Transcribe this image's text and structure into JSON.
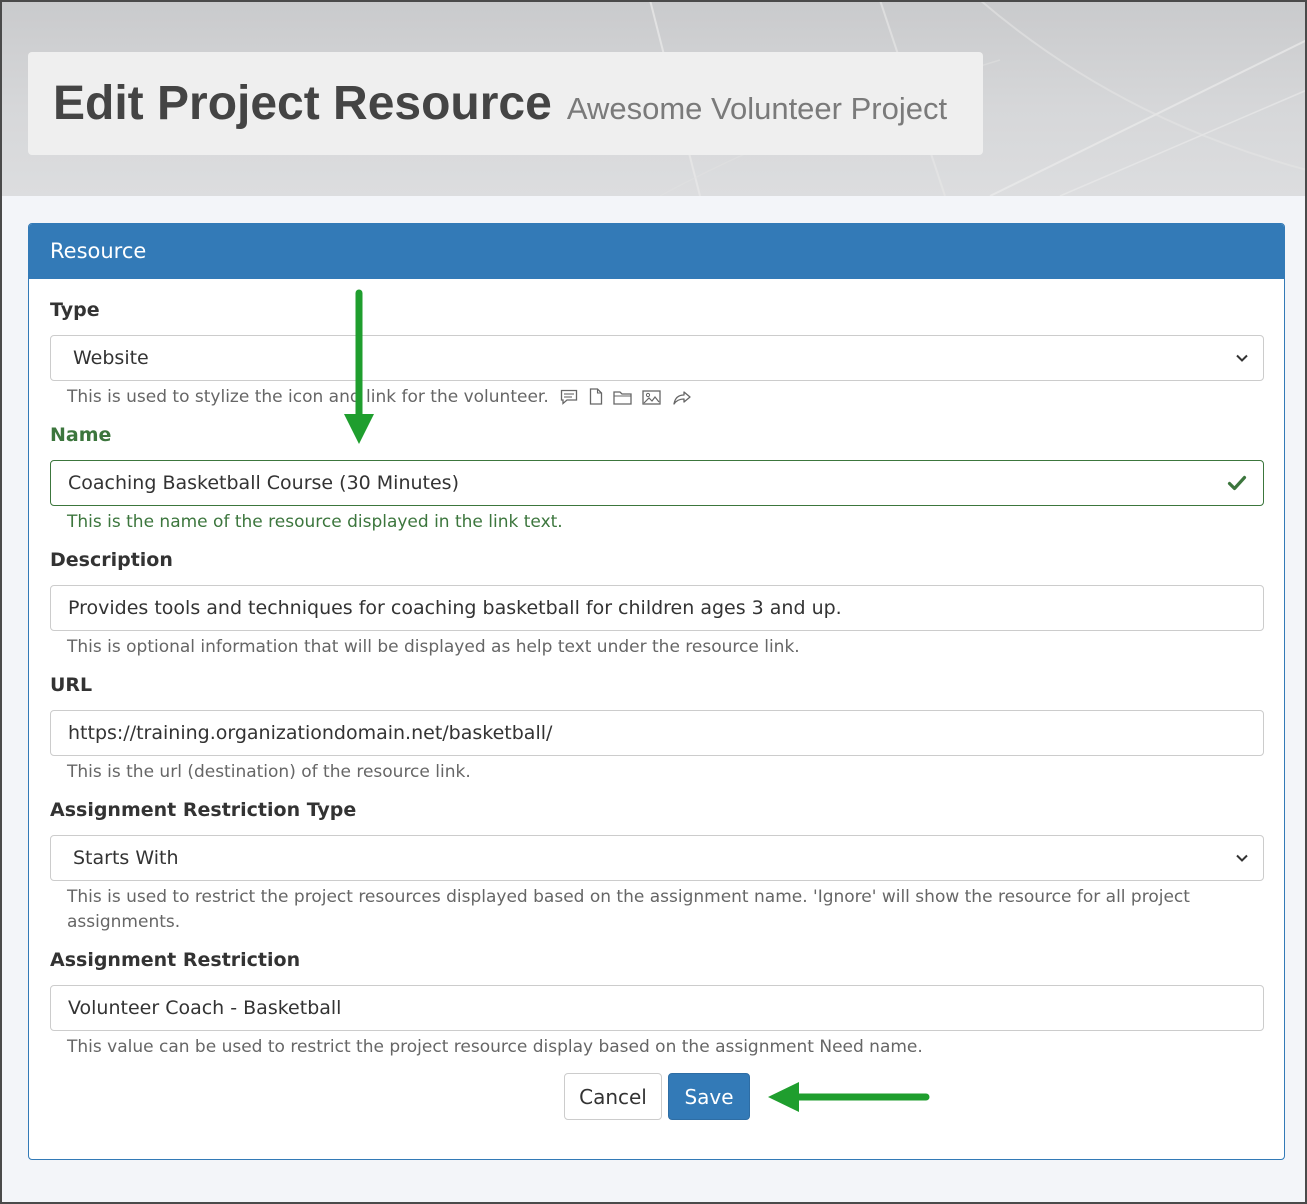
{
  "header": {
    "title": "Edit Project Resource",
    "subtitle": "Awesome Volunteer Project"
  },
  "panel": {
    "title": "Resource"
  },
  "form": {
    "type": {
      "label": "Type",
      "value": "Website",
      "help": "This is used to stylize the icon and link for the volunteer.",
      "icons": [
        "comment-icon",
        "file-icon",
        "folder-icon",
        "image-icon",
        "share-icon"
      ]
    },
    "name": {
      "label": "Name",
      "value": "Coaching Basketball Course (30 Minutes)",
      "help": "This is the name of the resource displayed in the link text.",
      "valid": true
    },
    "description": {
      "label": "Description",
      "value": "Provides tools and techniques for coaching basketball for children ages 3 and up.",
      "help": "This is optional information that will be displayed as help text under the resource link."
    },
    "url": {
      "label": "URL",
      "value": "https://training.organizationdomain.net/basketball/",
      "help": "This is the url (destination) of the resource link."
    },
    "restriction_type": {
      "label": "Assignment Restriction Type",
      "value": "Starts With",
      "help": "This is used to restrict the project resources displayed based on the assignment name. 'Ignore' will show the resource for all project assignments."
    },
    "restriction": {
      "label": "Assignment Restriction",
      "value": "Volunteer Coach - Basketball",
      "help": "This value can be used to restrict the project resource display based on the assignment Need name."
    }
  },
  "actions": {
    "cancel_label": "Cancel",
    "save_label": "Save"
  },
  "colors": {
    "primary": "#337ab7",
    "success": "#3c763d",
    "annotation_arrow": "#1f9e2e"
  }
}
